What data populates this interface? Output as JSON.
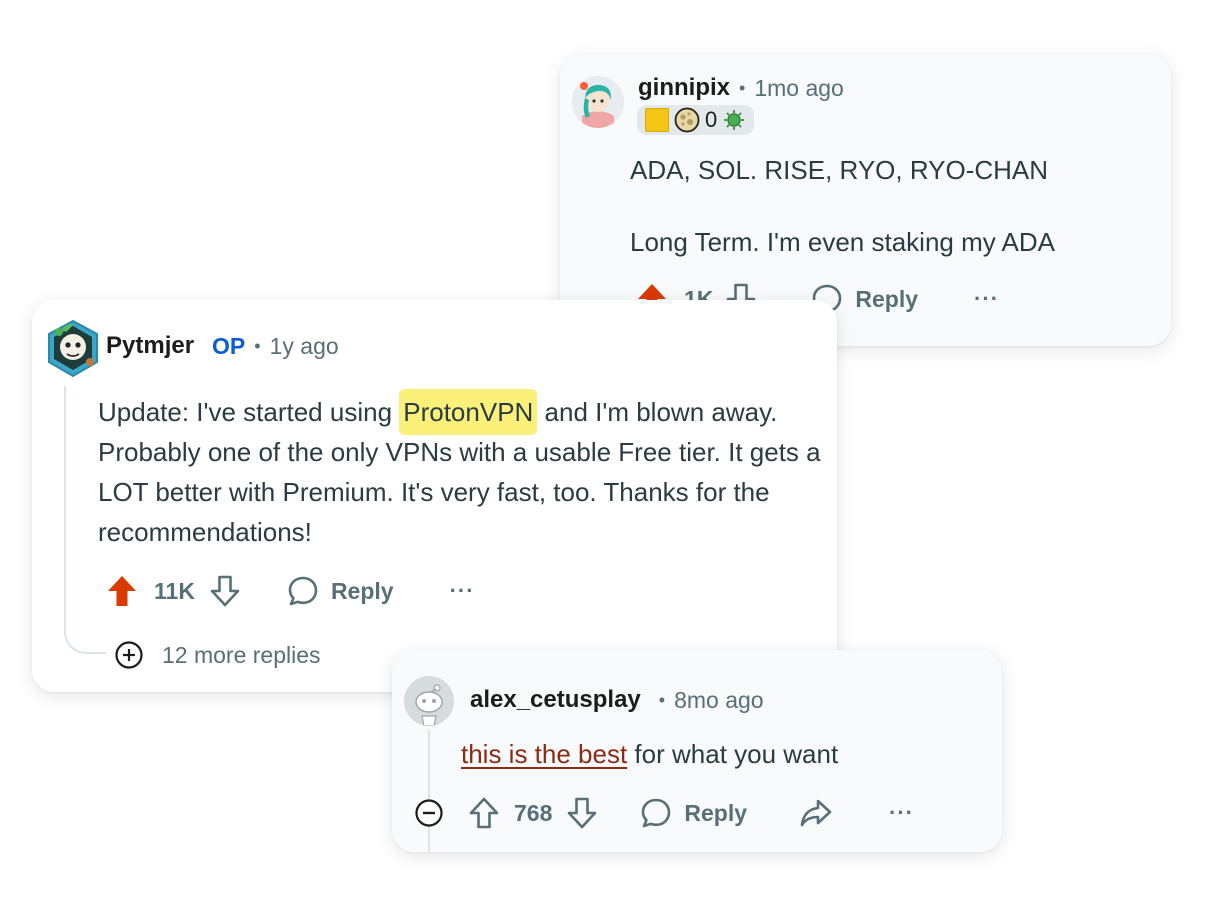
{
  "comment_top": {
    "username": "ginnipix",
    "time": "1mo ago",
    "flair_count": "0",
    "lines": [
      "ADA, SOL. RISE, RYO, RYO-CHAN",
      "Long Term. I'm even staking my ADA"
    ],
    "score": "1K",
    "reply_label": "Reply",
    "more_label": "···"
  },
  "comment_main": {
    "username": "Pytmjer",
    "op_label": "OP",
    "time": "1y ago",
    "text_pre": "Update: I've started using ",
    "text_highlight": "ProtonVPN",
    "text_post": " and I'm blown away. Probably one of the only VPNs with a usable Free tier. It gets a LOT better with Premium. It's very fast, too. Thanks for the recommendations!",
    "score": "11K",
    "reply_label": "Reply",
    "more_label": "···",
    "more_replies": "12 more replies"
  },
  "comment_bottom": {
    "username": "alex_cetusplay",
    "time": "8mo ago",
    "link_text": "this is the best",
    "text_post": " for what you want",
    "score": "768",
    "reply_label": "Reply",
    "more_label": "···"
  },
  "colors": {
    "upvote_active": "#d93a00",
    "highlight": "#fbf07a",
    "op_blue": "#0a5bd9",
    "link_red": "#8c2b14",
    "muted": "#576f76",
    "card_bg": "#f8fafb"
  },
  "icons": [
    "upvote-icon",
    "downvote-icon",
    "reply-bubble-icon",
    "share-icon",
    "expand-plus-icon",
    "collapse-minus-icon"
  ]
}
